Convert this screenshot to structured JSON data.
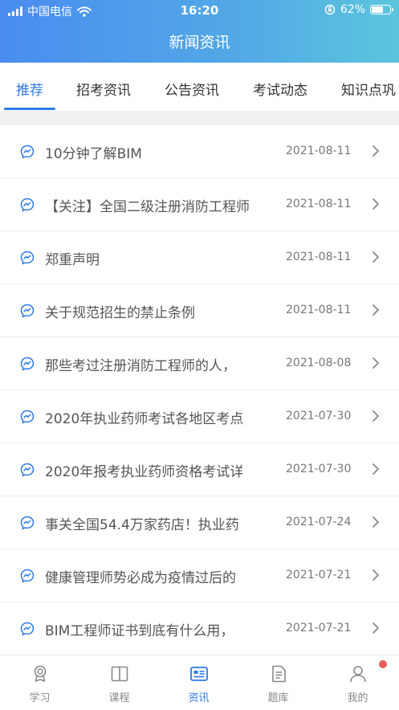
{
  "status_bar": {
    "carrier": "中国电信",
    "time": "16:20",
    "battery": "62%"
  },
  "header": {
    "title": "新闻资讯"
  },
  "tabs": [
    {
      "label": "推荐",
      "active": true
    },
    {
      "label": "招考资讯",
      "active": false
    },
    {
      "label": "公告资讯",
      "active": false
    },
    {
      "label": "考试动态",
      "active": false
    },
    {
      "label": "知识点巩",
      "active": false
    }
  ],
  "news": [
    {
      "title": "10分钟了解BIM",
      "date": "2021-08-11"
    },
    {
      "title": "【关注】全国二级注册消防工程师",
      "date": "2021-08-11"
    },
    {
      "title": "郑重声明",
      "date": "2021-08-11"
    },
    {
      "title": "关于规范招生的禁止条例",
      "date": "2021-08-11"
    },
    {
      "title": "那些考过注册消防工程师的人，",
      "date": "2021-08-08"
    },
    {
      "title": "2020年执业药师考试各地区考点",
      "date": "2021-07-30"
    },
    {
      "title": "2020年报考执业药师资格考试详",
      "date": "2021-07-30"
    },
    {
      "title": "事关全国54.4万家药店！执业药",
      "date": "2021-07-24"
    },
    {
      "title": " 健康管理师势必成为疫情过后的",
      "date": "2021-07-21"
    },
    {
      "title": "BIM工程师证书到底有什么用，",
      "date": "2021-07-21"
    }
  ],
  "tabbar": [
    {
      "label": "学习",
      "icon": "badge-icon",
      "active": false
    },
    {
      "label": "课程",
      "icon": "book-icon",
      "active": false
    },
    {
      "label": "资讯",
      "icon": "news-icon",
      "active": true
    },
    {
      "label": "题库",
      "icon": "document-icon",
      "active": false
    },
    {
      "label": "我的",
      "icon": "user-icon",
      "active": false
    }
  ],
  "colors": {
    "accent": "#2f7ae5",
    "header_start": "#4a8cf0",
    "header_end": "#5cc5dd",
    "notification_dot": "#e85a5a"
  }
}
